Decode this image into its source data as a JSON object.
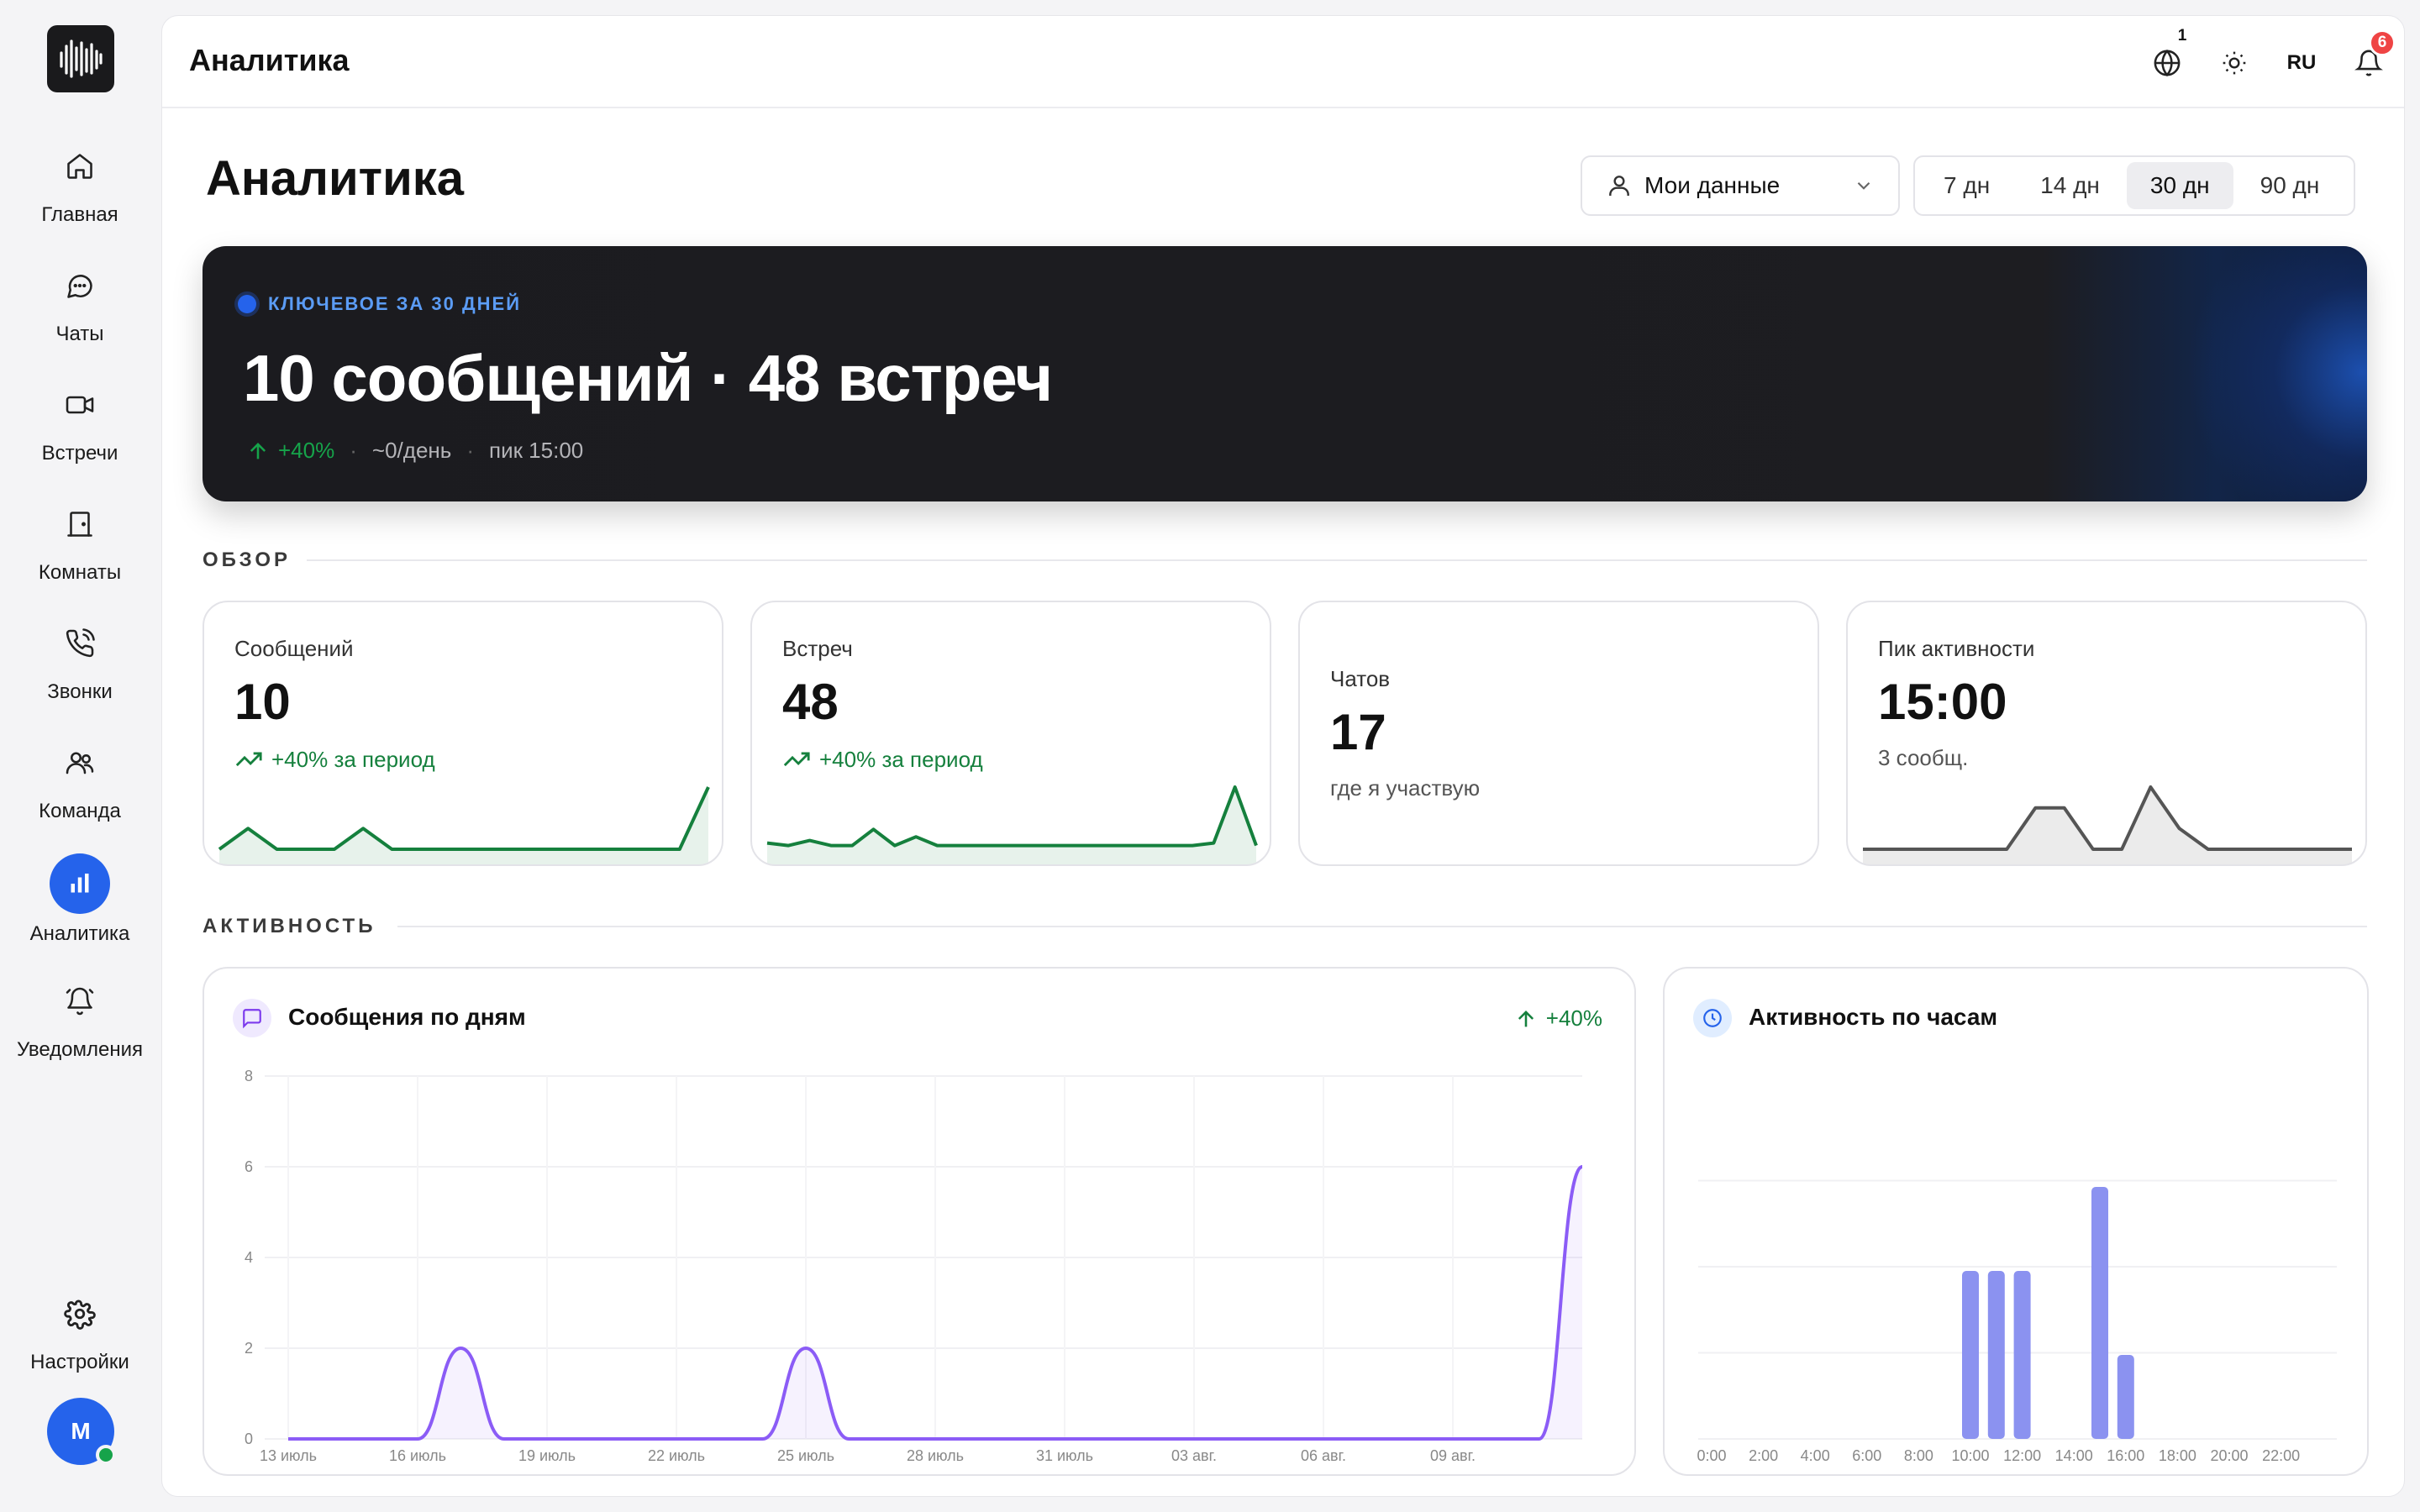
{
  "app": {
    "title": "Аналитика"
  },
  "sidebar": {
    "items": [
      {
        "label": "Главная",
        "icon": "home-icon"
      },
      {
        "label": "Чаты",
        "icon": "chat-icon"
      },
      {
        "label": "Встречи",
        "icon": "video-icon"
      },
      {
        "label": "Комнаты",
        "icon": "door-icon"
      },
      {
        "label": "Звонки",
        "icon": "phone-icon"
      },
      {
        "label": "Команда",
        "icon": "team-icon"
      },
      {
        "label": "Аналитика",
        "icon": "chart-icon",
        "active": true
      },
      {
        "label": "Уведомления",
        "icon": "bell-icon"
      }
    ],
    "settings_label": "Настройки",
    "avatar_initial": "M"
  },
  "topbar": {
    "title": "Аналитика",
    "globe_badge": "1",
    "lang": "RU",
    "notif_badge": "6"
  },
  "page": {
    "title": "Аналитика",
    "scope_select": "Мои данные",
    "periods": [
      "7 дн",
      "14 дн",
      "30 дн",
      "90 дн"
    ],
    "active_period": "30 дн"
  },
  "hero": {
    "kicker": "КЛЮЧЕВОЕ ЗА 30 ДНЕЙ",
    "headline": "10 сообщений · 48 встреч",
    "delta": "+40%",
    "per_day": "~0/день",
    "peak": "пик 15:00"
  },
  "overview": {
    "label": "ОБЗОР",
    "cards": [
      {
        "label": "Сообщений",
        "value": "10",
        "sub": "+40% за период",
        "trend": true,
        "spark": [
          0,
          1,
          0,
          0,
          0,
          1,
          0,
          0,
          0,
          0,
          0,
          0,
          0,
          0,
          0,
          0,
          0,
          3
        ]
      },
      {
        "label": "Встреч",
        "value": "48",
        "sub": "+40% за период",
        "trend": true,
        "spark": [
          0.5,
          0.3,
          0.7,
          0.3,
          0.3,
          1.6,
          0.3,
          1,
          0.3,
          0.3,
          0.3,
          0.3,
          0.3,
          0.3,
          0.3,
          0.3,
          0.3,
          0.3,
          0.3,
          0.3,
          0.3,
          0.5,
          5,
          0.3
        ]
      },
      {
        "label": "Чатов",
        "value": "17",
        "sub": "где я участвую",
        "trend": false
      },
      {
        "label": "Пик активности",
        "value": "15:00",
        "sub": "3 сообщ.",
        "trend": false,
        "spark": [
          0,
          0,
          0,
          0,
          0,
          0,
          2,
          2,
          0,
          0,
          3,
          1,
          0,
          0,
          0,
          0,
          0,
          0
        ]
      }
    ]
  },
  "activity": {
    "label": "АКТИВНОСТЬ",
    "daily": {
      "title": "Сообщения по дням",
      "delta": "+40%",
      "y_ticks": [
        "0",
        "2",
        "4",
        "6",
        "8"
      ],
      "x_ticks": [
        "13 июль",
        "16 июль",
        "19 июль",
        "22 июль",
        "25 июль",
        "28 июль",
        "31 июль",
        "03 авг.",
        "06 авг.",
        "09 авг."
      ]
    },
    "hourly": {
      "title": "Активность по часам",
      "x_ticks": [
        "0:00",
        "2:00",
        "4:00",
        "6:00",
        "8:00",
        "10:00",
        "12:00",
        "14:00",
        "16:00",
        "18:00",
        "20:00",
        "22:00"
      ]
    }
  },
  "chart_data": [
    {
      "type": "line",
      "title": "Сообщения по дням",
      "ylim": [
        0,
        8
      ],
      "x_ticks": [
        "13 июль",
        "16 июль",
        "19 июль",
        "22 июль",
        "25 июль",
        "28 июль",
        "31 июль",
        "03 авг.",
        "06 авг.",
        "09 авг."
      ],
      "series": [
        {
          "values": [
            0,
            0,
            0,
            0,
            2,
            0,
            0,
            0,
            0,
            0,
            0,
            0,
            2,
            0,
            0,
            0,
            0,
            0,
            0,
            0,
            0,
            0,
            0,
            0,
            0,
            0,
            0,
            0,
            0,
            0,
            6
          ]
        }
      ],
      "color": "#8b5cf6"
    },
    {
      "type": "bar",
      "title": "Активность по часам",
      "categories": [
        "0:00",
        "1:00",
        "2:00",
        "3:00",
        "4:00",
        "5:00",
        "6:00",
        "7:00",
        "8:00",
        "9:00",
        "10:00",
        "11:00",
        "12:00",
        "13:00",
        "14:00",
        "15:00",
        "16:00",
        "17:00",
        "18:00",
        "19:00",
        "20:00",
        "21:00",
        "22:00",
        "23:00"
      ],
      "values": [
        0,
        0,
        0,
        0,
        0,
        0,
        0,
        0,
        0,
        0,
        2,
        2,
        2,
        0,
        0,
        3,
        1,
        0,
        0,
        0,
        0,
        0,
        0,
        0
      ],
      "ylim": [
        0,
        3
      ],
      "color": "#8b92f0"
    }
  ],
  "colors": {
    "accent": "#2563eb",
    "green": "#15803d",
    "purple": "#8b5cf6",
    "bar": "#8b92f0"
  }
}
